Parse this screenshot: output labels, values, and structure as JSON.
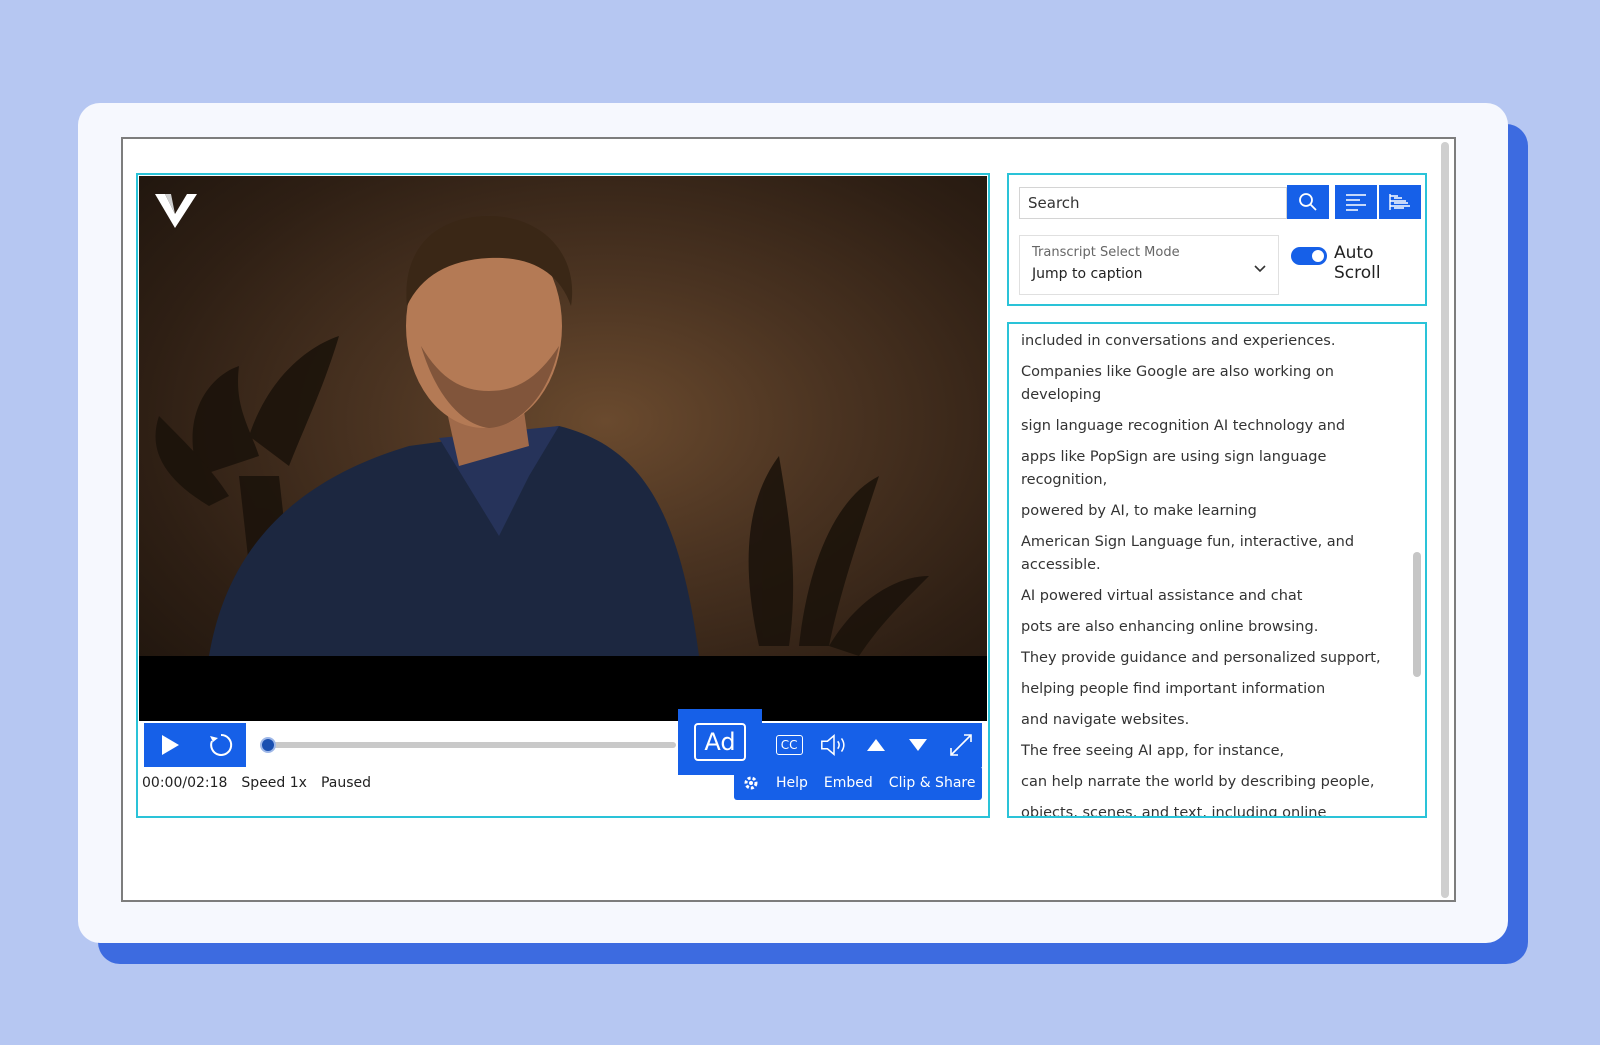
{
  "colors": {
    "accent": "#1660e8",
    "panel_border": "#2ac3d8",
    "background": "#b6c7f2"
  },
  "player": {
    "logo_icon": "v-logo-icon",
    "controls": {
      "play_icon": "play-icon",
      "replay_icon": "replay-icon",
      "ad_label": "Ad",
      "cc_label": "CC",
      "volume_icon": "volume-icon",
      "up_icon": "arrow-up-icon",
      "down_icon": "arrow-down-icon",
      "fullscreen_icon": "fullscreen-icon",
      "progress": 0
    },
    "status": {
      "time": "00:00/02:18",
      "speed": "Speed 1x",
      "state": "Paused"
    },
    "actions": {
      "settings_icon": "gear-icon",
      "help_label": "Help",
      "embed_label": "Embed",
      "clip_share_label": "Clip & Share"
    }
  },
  "transcript": {
    "search": {
      "placeholder": "Search",
      "search_icon": "search-icon",
      "format_icon": "align-left-icon",
      "tree_icon": "list-tree-icon"
    },
    "select_mode": {
      "label": "Transcript Select Mode",
      "value": "Jump to caption"
    },
    "auto_scroll": {
      "label": "Auto Scroll",
      "enabled": true
    },
    "lines": [
      "included in conversations and experiences.",
      "Companies like Google are also working on developing",
      "sign language recognition AI technology and",
      "apps like PopSign are using sign language recognition,",
      "powered by AI, to make learning",
      "American Sign Language fun, interactive, and accessible.",
      "AI powered virtual assistance and chat",
      "pots are also enhancing online browsing.",
      "They provide guidance and personalized support,",
      "helping people find important information",
      "and navigate websites.",
      "The free seeing AI app, for instance,",
      "can help narrate the world by describing people,",
      "objects, scenes, and text, including online"
    ]
  }
}
